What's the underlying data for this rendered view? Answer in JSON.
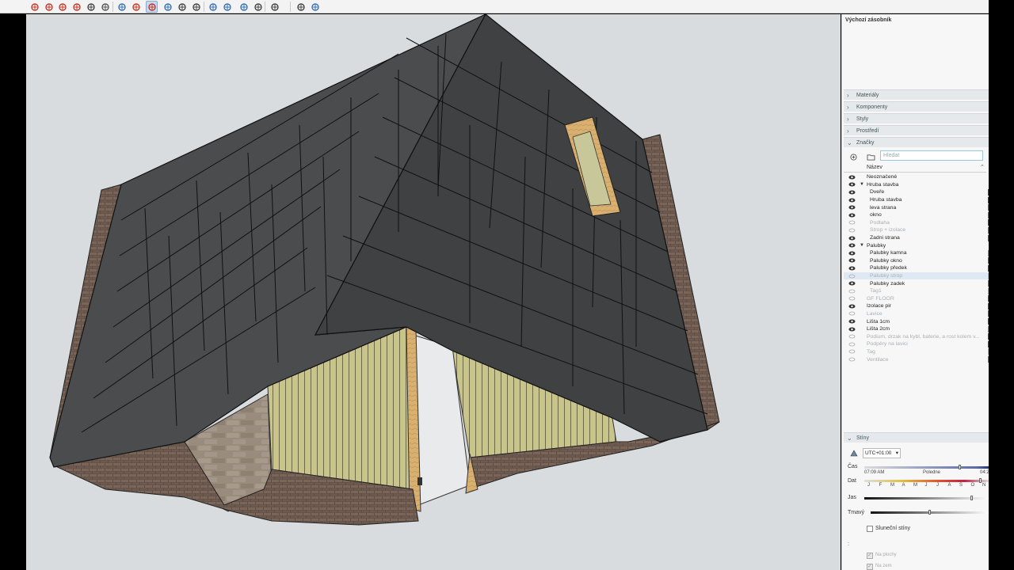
{
  "toolbar": {
    "icons": [
      "move-icon",
      "push-pull-icon",
      "rotate-icon",
      "offset-icon",
      "section-plane-icon",
      "tape-measure-icon",
      "protractor-icon",
      "orbit-icon",
      "walk-icon",
      "look-around-icon",
      "pan-icon",
      "zoom-icon",
      "zoom-extents-icon",
      "previous-view-icon",
      "generate-report-icon",
      "outliner-icon",
      "classifier-icon",
      "profile-icon",
      "new-model-icon",
      "user-icon"
    ]
  },
  "tray": {
    "title": "Výchozí zásobník",
    "sections": [
      "Materiály",
      "Komponenty",
      "Styly",
      "Prostředí",
      "Značky"
    ],
    "tags": {
      "search_placeholder": "Hledat",
      "column_header": "Název",
      "rows": [
        {
          "label": "Neoznačené",
          "visible": true,
          "indent": 1,
          "color": ""
        },
        {
          "label": "Hruba stavba",
          "visible": true,
          "indent": 1,
          "folder": true,
          "color": ""
        },
        {
          "label": "Dveře",
          "visible": true,
          "indent": 2,
          "color": "#6a2bb5"
        },
        {
          "label": "Hruba stavba",
          "visible": true,
          "indent": 2,
          "color": "#3b3b9e"
        },
        {
          "label": "leva strana",
          "visible": true,
          "indent": 2,
          "color": "#b25a1a"
        },
        {
          "label": "okno",
          "visible": true,
          "indent": 2,
          "color": "#c05a1b"
        },
        {
          "label": "Podlaha",
          "visible": false,
          "indent": 2,
          "color": "#5a3a8a"
        },
        {
          "label": "Strop + izolace",
          "visible": false,
          "indent": 2,
          "color": "#c75b2a"
        },
        {
          "label": "Zadni strana",
          "visible": true,
          "indent": 2,
          "color": "#2a7a7a"
        },
        {
          "label": "Palubky",
          "visible": true,
          "indent": 1,
          "folder": true,
          "color": ""
        },
        {
          "label": "Palubky kamna",
          "visible": true,
          "indent": 2,
          "color": "#d08a1a"
        },
        {
          "label": "Palubky okno",
          "visible": true,
          "indent": 2,
          "color": "#3a6fb0"
        },
        {
          "label": "Palubky předek",
          "visible": true,
          "indent": 2,
          "color": "#7a4a22"
        },
        {
          "label": "Palubky strop",
          "visible": false,
          "indent": 2,
          "color": "#b0c4de",
          "selected": true
        },
        {
          "label": "Palubky zadek",
          "visible": true,
          "indent": 2,
          "color": "#c06a3a"
        },
        {
          "label": "Tag1",
          "visible": false,
          "indent": 2,
          "color": "#98c85a"
        },
        {
          "label": "GF FLOOR",
          "visible": false,
          "indent": 1,
          "color": "#7a3ac0"
        },
        {
          "label": "Izolace pir",
          "visible": true,
          "indent": 1,
          "color": "#9a1ab0"
        },
        {
          "label": "Lavice",
          "visible": false,
          "indent": 1,
          "color": "#5a5ab0"
        },
        {
          "label": "Lišta 1cm",
          "visible": true,
          "indent": 1,
          "color": "#a02a2a"
        },
        {
          "label": "Lišta 2cm",
          "visible": true,
          "indent": 1,
          "color": "#8a8a9a"
        },
        {
          "label": "Podium, drzak na kybl, baterie, a rost kolem v...",
          "visible": false,
          "indent": 1,
          "color": "#6a3a8a"
        },
        {
          "label": "Podpěry na lavici",
          "visible": false,
          "indent": 1,
          "color": "#7a2a9a"
        },
        {
          "label": "Tag",
          "visible": false,
          "indent": 1,
          "color": "#d6c81a"
        },
        {
          "label": "Ventilace",
          "visible": false,
          "indent": 1,
          "color": "#6a8a2a"
        }
      ]
    },
    "shadows": {
      "title": "Stíny",
      "timezone": "UTC+01:00",
      "time_label": "Čas",
      "time_start": "07:09 AM",
      "time_mid": "Poledne",
      "time_end": "04:2",
      "date_label": "Dat",
      "months": [
        "J",
        "F",
        "M",
        "A",
        "M",
        "J",
        "J",
        "A",
        "S",
        "O",
        "N"
      ],
      "brightness_label": "Jas",
      "dark_label": "Tmavý",
      "sun_shadows": "Sluneční stíny",
      "colon": ":",
      "on_faces": "Na plochy",
      "on_ground": "Na zem"
    }
  }
}
